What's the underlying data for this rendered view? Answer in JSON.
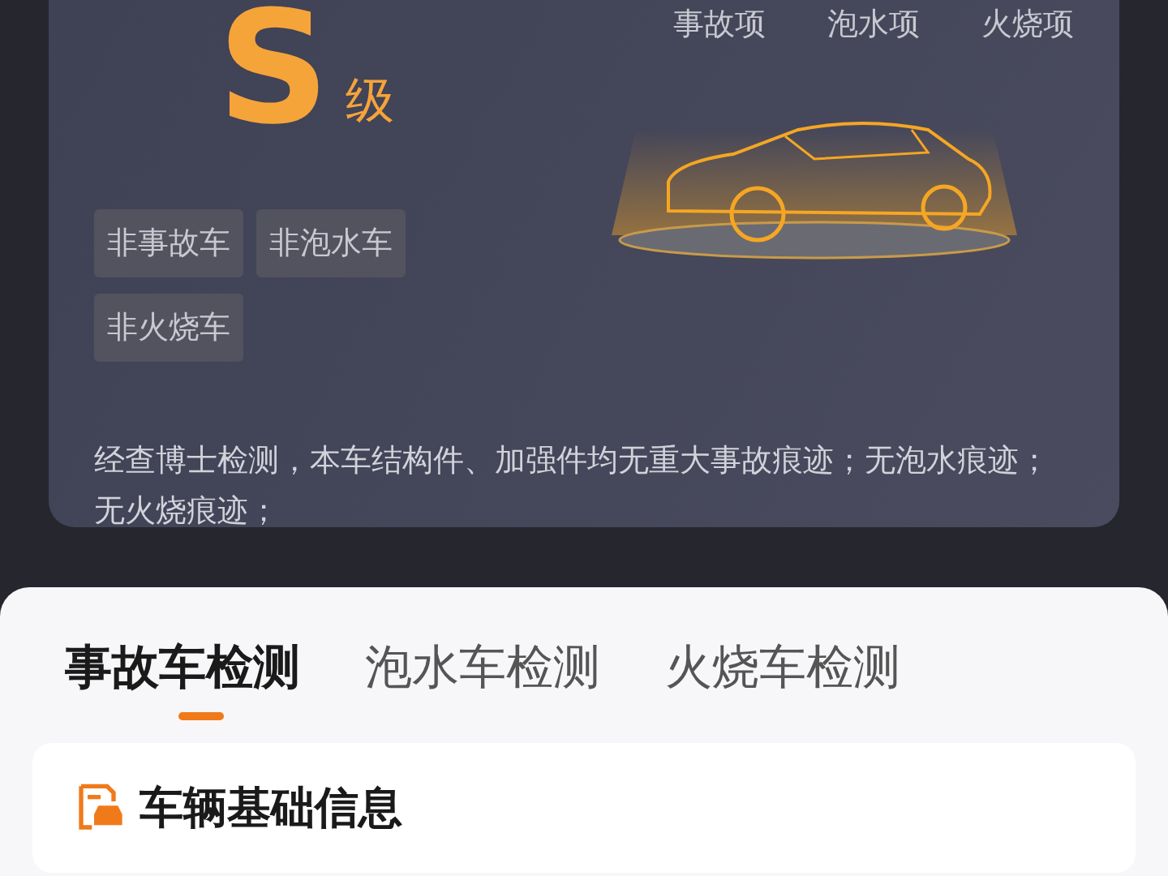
{
  "grade": {
    "letter": "S",
    "suffix": "级"
  },
  "check_items": [
    "事故项",
    "泡水项",
    "火烧项"
  ],
  "tags": [
    "非事故车",
    "非泡水车",
    "非火烧车"
  ],
  "summary": "经查博士检测，本车结构件、加强件均无重大事故痕迹；无泡水痕迹；无火烧痕迹；",
  "tabs": [
    {
      "label": "事故车检测",
      "selected": true
    },
    {
      "label": "泡水车检测",
      "selected": false
    },
    {
      "label": "火烧车检测",
      "selected": false
    }
  ],
  "section": {
    "title": "车辆基础信息"
  }
}
